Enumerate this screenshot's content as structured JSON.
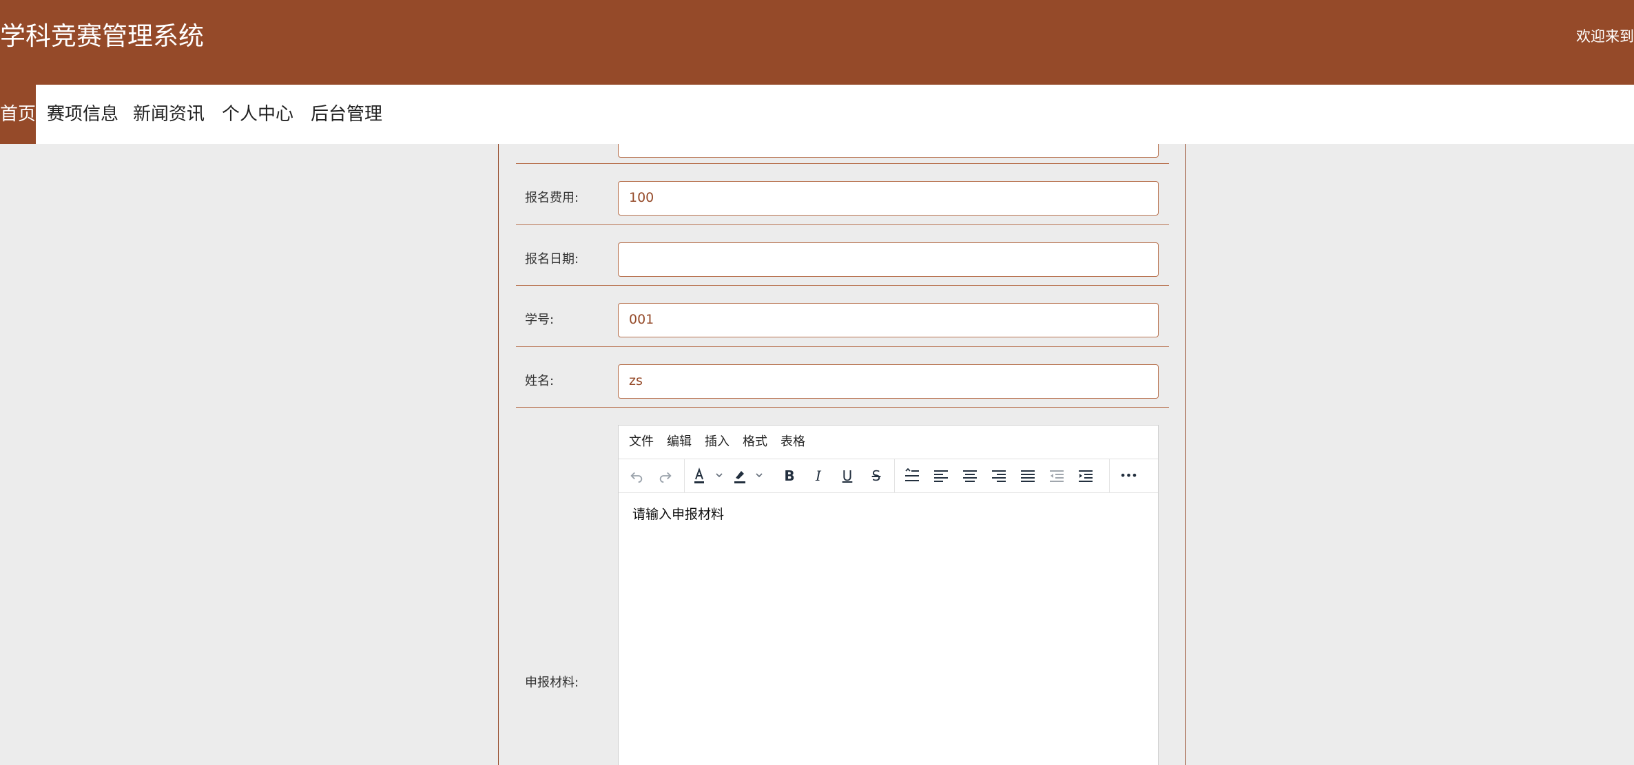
{
  "header": {
    "title": "学科竞赛管理系统",
    "welcome": "欢迎来到",
    "bg_color": "#954a29"
  },
  "nav": {
    "items": [
      {
        "label": "首页",
        "active": true
      },
      {
        "label": "赛项信息",
        "active": false
      },
      {
        "label": "新闻资讯",
        "active": false
      },
      {
        "label": "个人中心",
        "active": false
      },
      {
        "label": "后台管理",
        "active": false
      }
    ]
  },
  "form": {
    "fee": {
      "label": "报名费用:",
      "value": "100"
    },
    "date": {
      "label": "报名日期:",
      "value": ""
    },
    "student_id": {
      "label": "学号:",
      "value": "001"
    },
    "name": {
      "label": "姓名:",
      "value": "zs"
    },
    "material": {
      "label": "申报材料:"
    }
  },
  "editor": {
    "menus": [
      "文件",
      "编辑",
      "插入",
      "格式",
      "表格"
    ],
    "toolbar_icons": [
      "undo-icon",
      "redo-icon",
      "text-color-icon",
      "highlight-icon",
      "bold-icon",
      "italic-icon",
      "underline-icon",
      "strikethrough-icon",
      "line-height-icon",
      "align-left-icon",
      "align-center-icon",
      "align-right-icon",
      "align-justify-icon",
      "outdent-icon",
      "indent-icon",
      "more-icon"
    ],
    "toolbar_glyphs": {
      "bold": "B",
      "italic": "I",
      "underline": "U",
      "strike": "S",
      "more": "•••"
    },
    "content": "请输入申报材料"
  }
}
